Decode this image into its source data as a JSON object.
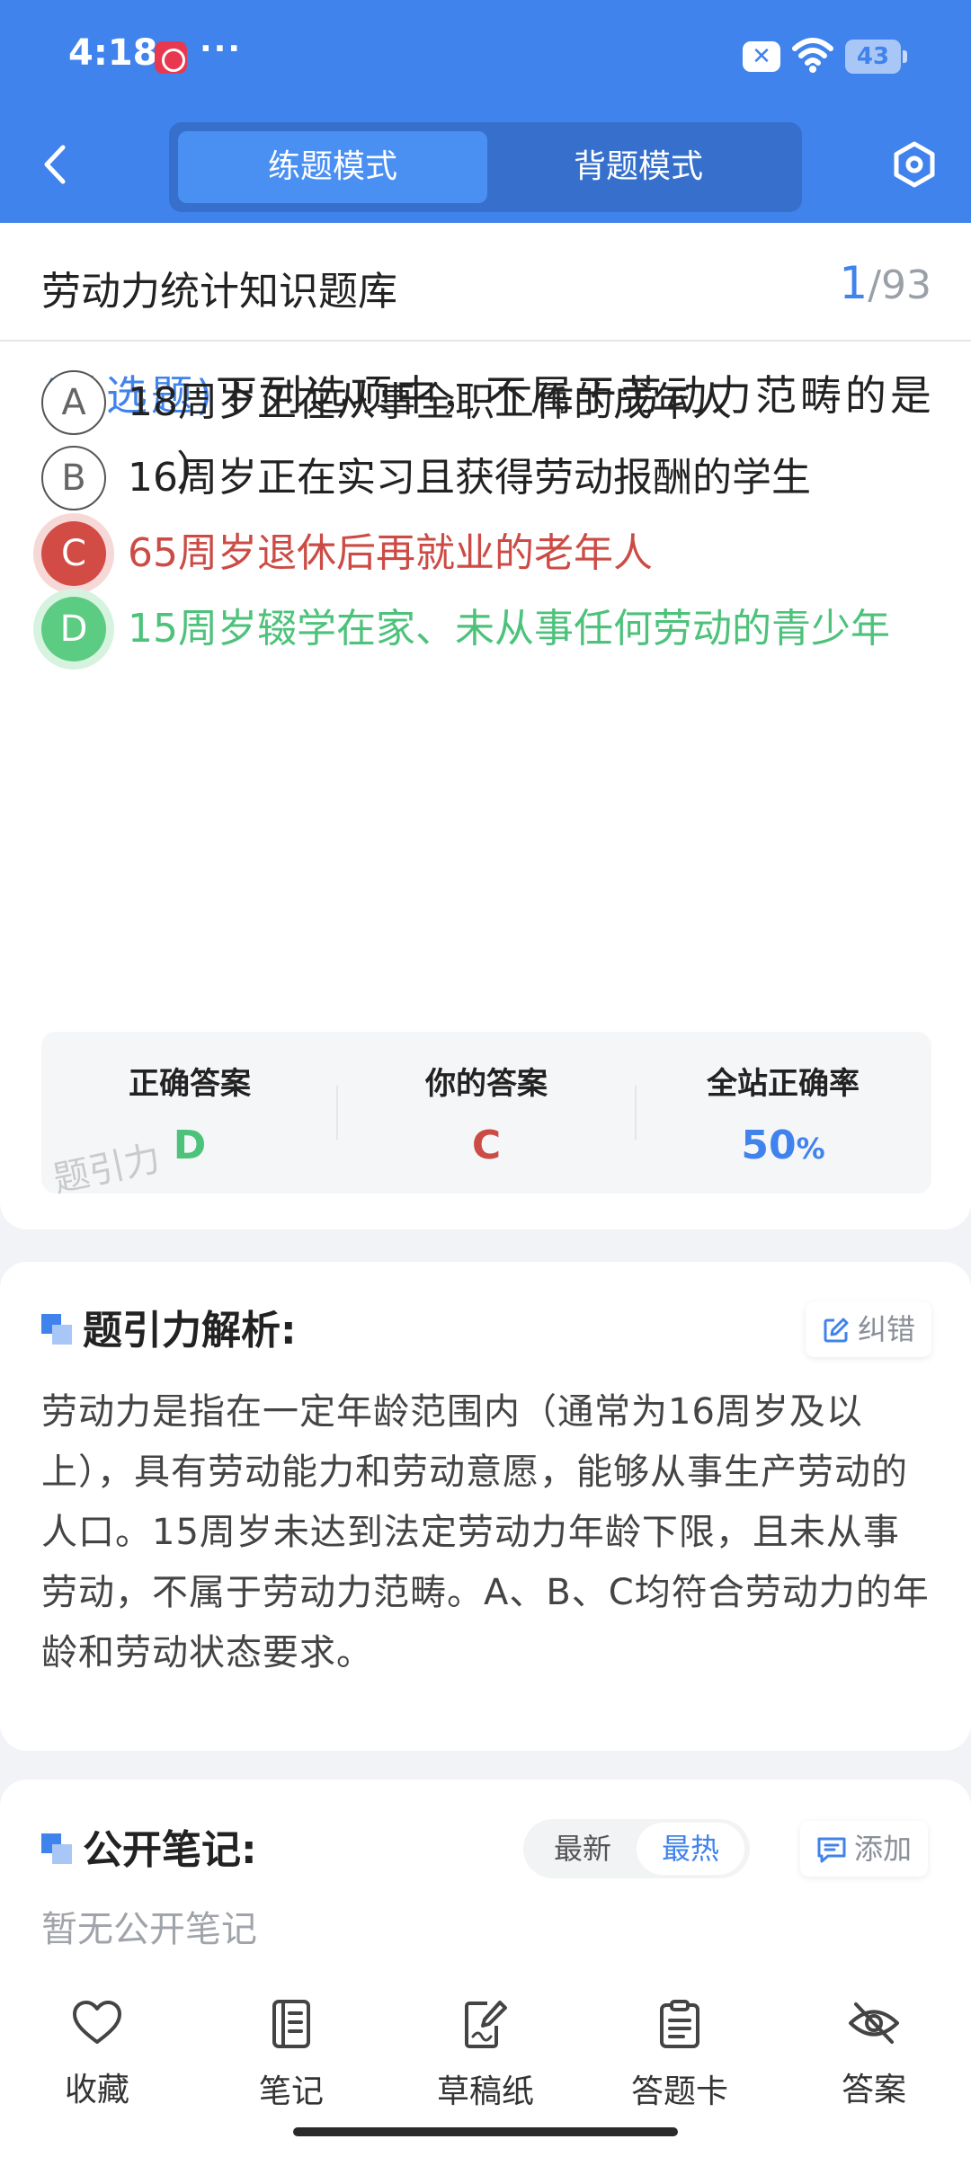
{
  "status_bar": {
    "time": "4:18",
    "dots": "···",
    "sim_label": "✕",
    "battery": "43"
  },
  "header": {
    "tabs": [
      {
        "label": "练题模式",
        "active": true
      },
      {
        "label": "背题模式",
        "active": false
      }
    ],
    "icons": [
      "back-icon",
      "settings-icon"
    ]
  },
  "question": {
    "bank_title": "劳动力统计知识题库",
    "current": "1",
    "total_label": "/93",
    "type_label": "(单选题)",
    "text": "下列选项中，不属于劳动力范畴的是（　　）",
    "options": [
      {
        "letter": "A",
        "text": "18周岁正在从事全职工作的成年人",
        "state": "normal"
      },
      {
        "letter": "B",
        "text": "16周岁正在实习且获得劳动报酬的学生",
        "state": "normal"
      },
      {
        "letter": "C",
        "text": "65周岁退休后再就业的老年人",
        "state": "wrong"
      },
      {
        "letter": "D",
        "text": "15周岁辍学在家、未从事任何劳动的青少年",
        "state": "correct"
      }
    ],
    "result": {
      "correct_label": "正确答案",
      "correct_value": "D",
      "yours_label": "你的答案",
      "yours_value": "C",
      "rate_label": "全站正确率",
      "rate_value": "50",
      "rate_unit": "%",
      "watermark": "题引力"
    }
  },
  "analysis": {
    "title": "题引力解析:",
    "report_button": "纠错",
    "text": "劳动力是指在一定年龄范围内（通常为16周岁及以上），具有劳动能力和劳动意愿，能够从事生产劳动的人口。15周岁未达到法定劳动力年龄下限，且未从事劳动，不属于劳动力范畴。A、B、C均符合劳动力的年龄和劳动状态要求。"
  },
  "notes": {
    "title": "公开笔记:",
    "sort_latest": "最新",
    "sort_hottest": "最热",
    "add_button": "添加",
    "empty_text": "暂无公开笔记"
  },
  "bottom_bar": {
    "items": [
      {
        "label": "收藏",
        "icon": "heart-icon"
      },
      {
        "label": "笔记",
        "icon": "notebook-icon"
      },
      {
        "label": "草稿纸",
        "icon": "draft-icon"
      },
      {
        "label": "答题卡",
        "icon": "clipboard-icon"
      },
      {
        "label": "答案",
        "icon": "eye-off-icon"
      }
    ]
  },
  "colors": {
    "primary": "#4083ec",
    "correct": "#4cc27a",
    "wrong": "#cc4b45"
  }
}
